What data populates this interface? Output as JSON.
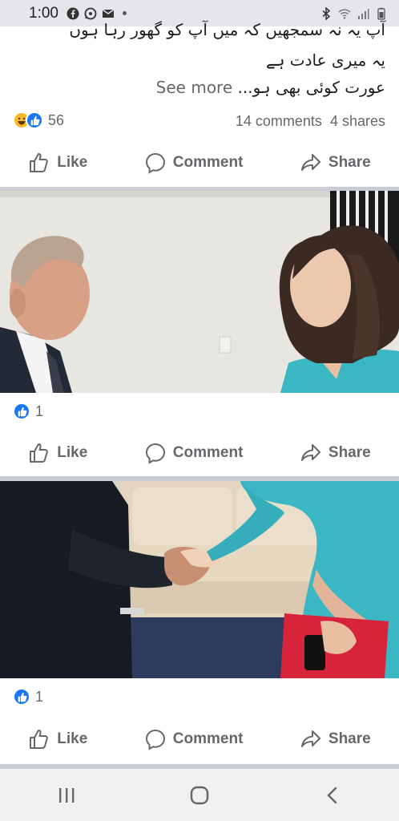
{
  "status_bar": {
    "time": "1:00"
  },
  "post1": {
    "text_lines": [
      "آپ یہ نہ سمجھیں کہ میں آپ کو گھور رہا ہوں",
      "یہ میری عادت ہے",
      "عورت کوئی بھی ہو..."
    ],
    "see_more": "See more",
    "reaction_count": "56",
    "comments": "14 comments",
    "shares": "4 shares"
  },
  "post2": {
    "reaction_count": "1"
  },
  "post3": {
    "reaction_count": "1"
  },
  "actions": {
    "like": "Like",
    "comment": "Comment",
    "share": "Share"
  },
  "colors": {
    "like_blue": "#1877f2",
    "teal_dress": "#3bb7c4",
    "divider": "#c9ccd1"
  }
}
